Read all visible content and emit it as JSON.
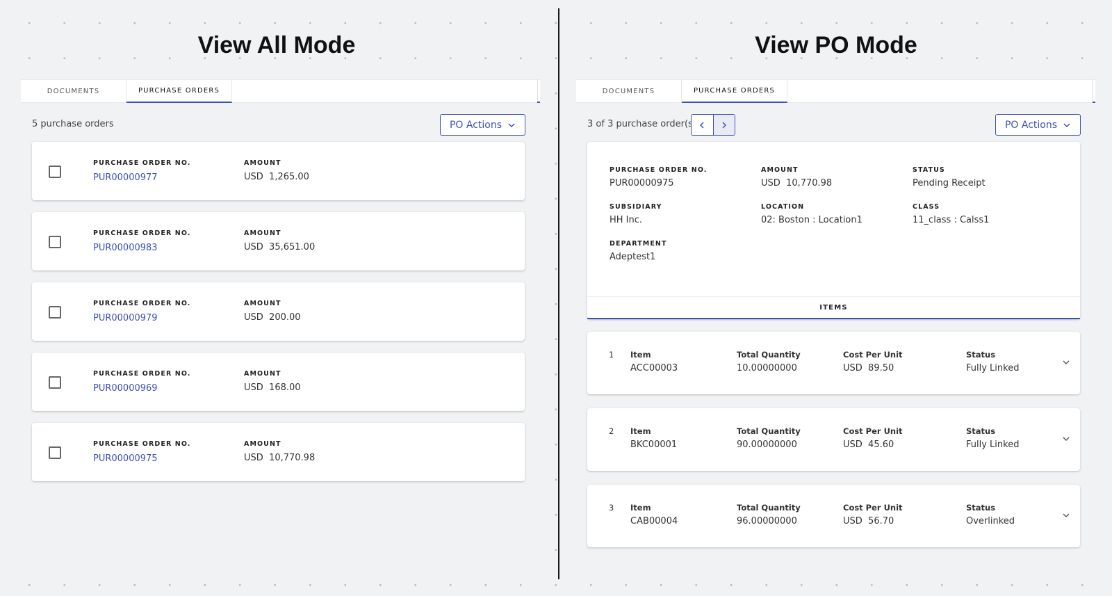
{
  "left": {
    "heading": "View All Mode",
    "tabs": [
      "DOCUMENTS",
      "PURCHASE ORDERS"
    ],
    "count_text": "5 purchase orders",
    "actions_label": "PO Actions",
    "po_label": "PURCHASE ORDER NO.",
    "amount_label": "AMOUNT",
    "orders": [
      {
        "po": "PUR00000977",
        "currency": "USD",
        "amount": "1,265.00"
      },
      {
        "po": "PUR00000983",
        "currency": "USD",
        "amount": "35,651.00"
      },
      {
        "po": "PUR00000979",
        "currency": "USD",
        "amount": "200.00"
      },
      {
        "po": "PUR00000969",
        "currency": "USD",
        "amount": "168.00"
      },
      {
        "po": "PUR00000975",
        "currency": "USD",
        "amount": "10,770.98"
      }
    ]
  },
  "right": {
    "heading": "View PO Mode",
    "tabs": [
      "DOCUMENTS",
      "PURCHASE ORDERS"
    ],
    "count_text": "3 of 3 purchase order(s)",
    "actions_label": "PO Actions",
    "detail": {
      "po_label": "PURCHASE ORDER NO.",
      "po": "PUR00000975",
      "amount_label": "AMOUNT",
      "amount": "USD  10,770.98",
      "status_label": "STATUS",
      "status": "Pending Receipt",
      "subsidiary_label": "SUBSIDIARY",
      "subsidiary": "HH Inc.",
      "location_label": "LOCATION",
      "location": "02: Boston : Location1",
      "class_label": "CLASS",
      "class": "11_class : Calss1",
      "department_label": "DEPARTMENT",
      "department": "Adeptest1",
      "items_tab": "ITEMS"
    },
    "item_labels": {
      "item": "Item",
      "qty": "Total Quantity",
      "cost": "Cost Per Unit",
      "status": "Status"
    },
    "items": [
      {
        "idx": "1",
        "item": "ACC00003",
        "qty": "10.00000000",
        "cost": "USD  89.50",
        "status": "Fully Linked"
      },
      {
        "idx": "2",
        "item": "BKC00001",
        "qty": "90.00000000",
        "cost": "USD  45.60",
        "status": "Fully Linked"
      },
      {
        "idx": "3",
        "item": "CAB00004",
        "qty": "96.00000000",
        "cost": "USD  56.70",
        "status": "Overlinked"
      }
    ]
  },
  "colors": {
    "accent": "#3f51b5",
    "background": "#f1f2f4"
  }
}
